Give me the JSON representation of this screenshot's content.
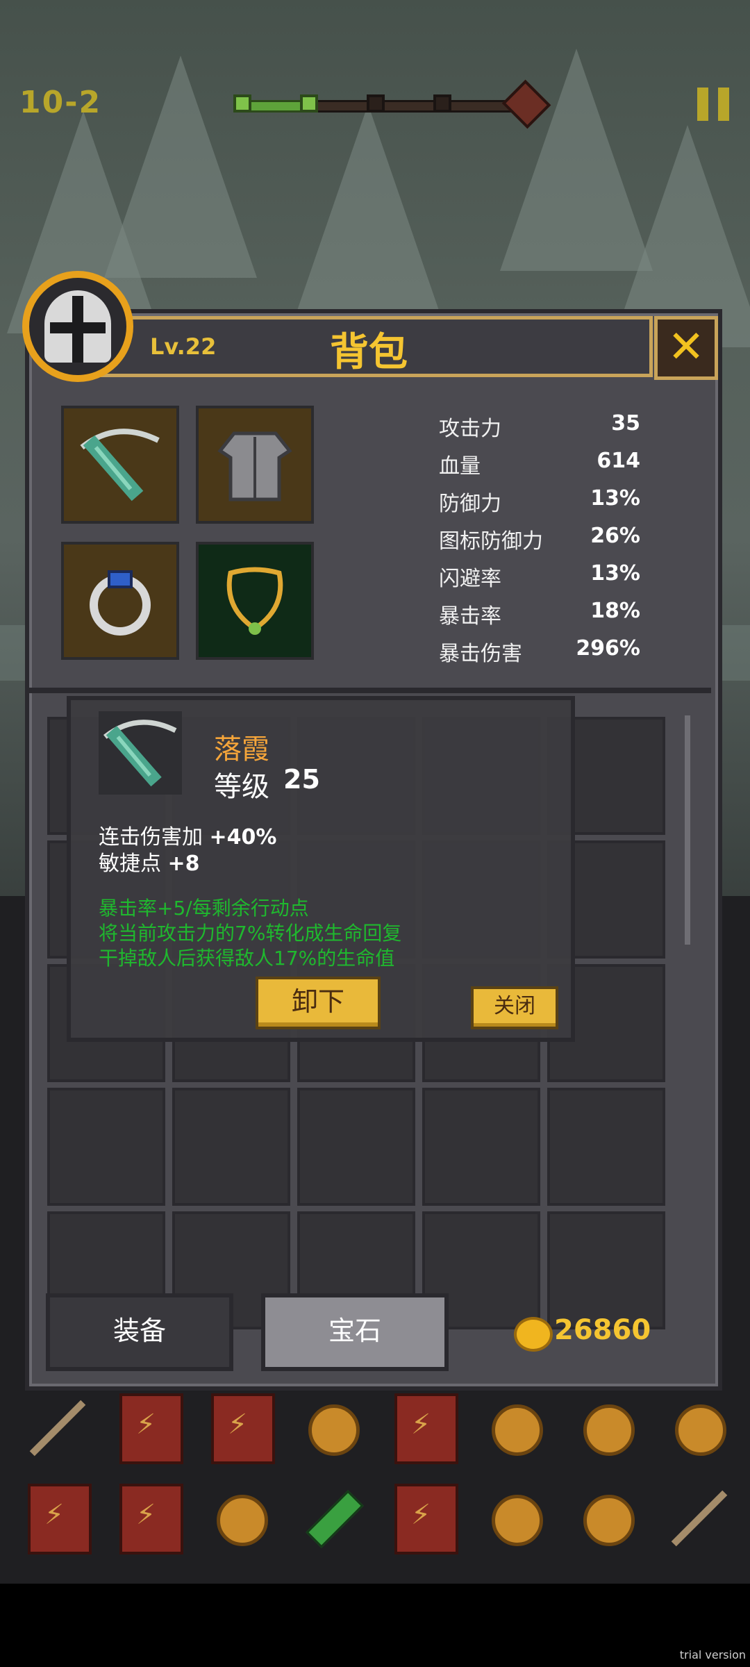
{
  "hud": {
    "stage": "10-2"
  },
  "panel": {
    "title": "背包",
    "level": "Lv.22",
    "close_glyph": "✕",
    "stats": [
      {
        "name": "攻击力",
        "value": "35"
      },
      {
        "name": "血量",
        "value": "614"
      },
      {
        "name": "防御力",
        "value": "13%"
      },
      {
        "name": "图标防御力",
        "value": "26%"
      },
      {
        "name": "闪避率",
        "value": "13%"
      },
      {
        "name": "暴击率",
        "value": "18%"
      },
      {
        "name": "暴击伤害",
        "value": "296%"
      }
    ],
    "equipment_icons": [
      "crossbow-icon",
      "armor-icon",
      "ring-icon",
      "necklace-icon"
    ]
  },
  "item_detail": {
    "name": "落霞",
    "level_label": "等级",
    "level": "25",
    "attributes": [
      {
        "label": "连击伤害加",
        "value": "+40%"
      },
      {
        "label": "敏捷点",
        "value": "+8"
      }
    ],
    "specials": [
      "暴击率+5/每剩余行动点",
      "将当前攻击力的7%转化成生命回复",
      "干掉敌人后获得敌人17%的生命值"
    ],
    "unequip_label": "卸下",
    "close_label": "关闭"
  },
  "tabs": {
    "equip": "装备",
    "gem": "宝石"
  },
  "gold": "26860",
  "item_bar": {
    "row1": [
      "spear-icon",
      "skill-book-icon",
      "skill-book-icon",
      "coin-icon",
      "skill-book-icon",
      "coin-icon",
      "coin-icon",
      "coin-icon"
    ],
    "row2": [
      "skill-book-icon",
      "skill-book-icon",
      "coin-icon",
      "potion-icon",
      "skill-book-icon",
      "coin-icon",
      "coin-icon",
      "spear-icon"
    ]
  },
  "footer": {
    "watermark": "trial version"
  },
  "colors": {
    "accent_gold": "#f5c531",
    "special_green": "#1fb82e",
    "item_name_orange": "#f5a53a"
  }
}
